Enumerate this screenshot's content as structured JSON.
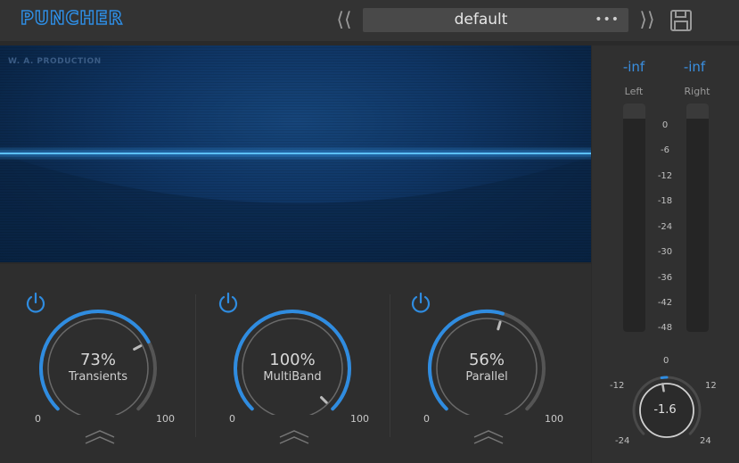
{
  "header": {
    "logo_text": "PUNCHER",
    "preset_name": "default",
    "preset_more": "•••",
    "prev_glyph": "⟨⟨",
    "next_glyph": "⟩⟩"
  },
  "scope": {
    "brand_text": "W. A. PRODUCTION"
  },
  "knobs": [
    {
      "name": "Transients",
      "value_text": "73%",
      "value": 73,
      "min_label": "0",
      "max_label": "100",
      "enabled": true
    },
    {
      "name": "MultiBand",
      "value_text": "100%",
      "value": 100,
      "min_label": "0",
      "max_label": "100",
      "enabled": true
    },
    {
      "name": "Parallel",
      "value_text": "56%",
      "value": 56,
      "min_label": "0",
      "max_label": "100",
      "enabled": true
    }
  ],
  "meter": {
    "left": {
      "peak": "-inf",
      "label": "Left"
    },
    "right": {
      "peak": "-inf",
      "label": "Right"
    },
    "scale": [
      "0",
      "-6",
      "-12",
      "-18",
      "-24",
      "-30",
      "-36",
      "-42",
      "-48"
    ]
  },
  "output_knob": {
    "value_text": "-1.6",
    "value": -1.6,
    "labels": {
      "top": "0",
      "left_mid": "-12",
      "right_mid": "12",
      "left_bottom": "-24",
      "right_bottom": "24"
    }
  },
  "colors": {
    "accent": "#2f8ce0",
    "track": "#555555",
    "background": "#2a2a2a"
  }
}
